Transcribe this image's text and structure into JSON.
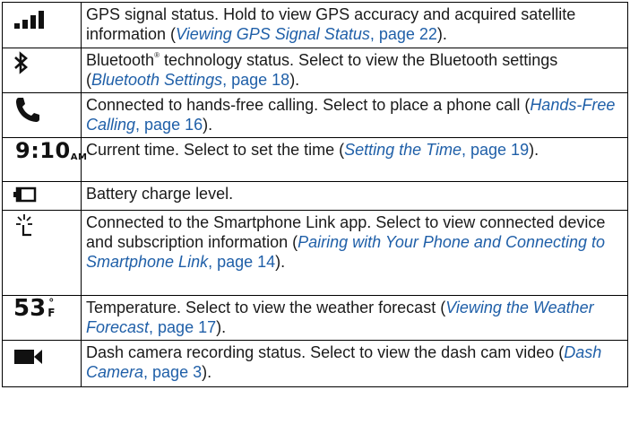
{
  "rows": [
    {
      "icon": "signal-bars-icon",
      "text": "GPS signal status. Hold to view GPS accuracy and acquired satellite information (",
      "link": "Viewing GPS Signal Status",
      "page": ", page 22",
      "tail": ")."
    },
    {
      "icon": "bluetooth-icon",
      "text_a": "Bluetooth",
      "reg": "®",
      "text_b": " technology status. Select to view the Bluetooth settings (",
      "link": "Bluetooth Settings",
      "page": ", page 18",
      "tail": ")."
    },
    {
      "icon": "phone-icon",
      "text": "Connected to hands-free calling. Select to place a phone call (",
      "link": "Hands-Free Calling",
      "page": ", page 16",
      "tail": ")."
    },
    {
      "icon": "clock-icon",
      "time": "9:10",
      "meridiem": "AM",
      "text": "Current time. Select to set the time (",
      "link": "Setting the Time",
      "page": ", page 19",
      "tail": ")."
    },
    {
      "icon": "battery-icon",
      "text": "Battery charge level."
    },
    {
      "icon": "smartphone-link-icon",
      "text": "Connected to the Smartphone Link app. Select to view connected device and subscription information (",
      "link": "Pairing with Your Phone and Connecting to Smartphone Link",
      "page": ", page 14",
      "tail": ")."
    },
    {
      "icon": "temperature-icon",
      "temp": "53",
      "degree": "°",
      "unit": "F",
      "text": "Temperature. Select to view the weather forecast (",
      "link": "Viewing the Weather Forecast",
      "page": ", page 17",
      "tail": ")."
    },
    {
      "icon": "video-camera-icon",
      "text": "Dash camera recording status. Select to view the dash cam video (",
      "link": "Dash Camera",
      "page": ", page 3",
      "tail": ")."
    }
  ]
}
